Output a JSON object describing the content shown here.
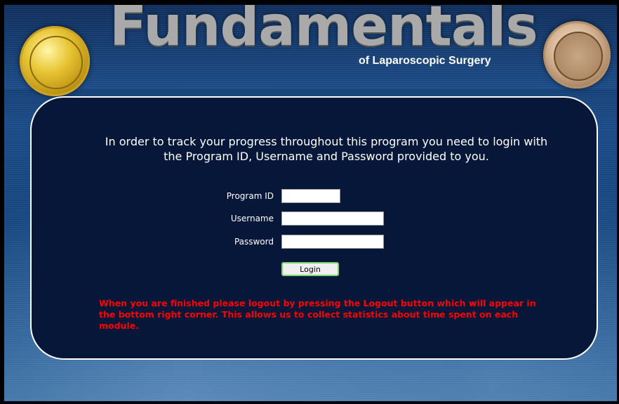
{
  "header": {
    "title": "Fundamentals",
    "subtitle": "of Laparoscopic Surgery"
  },
  "icons": {
    "left_seal": "gold-emblem-seal",
    "right_seal": "college-of-surgeons-seal"
  },
  "login": {
    "intro_text": "In order to track your progress throughout this program you need to login with the Program ID, Username and Password provided to you.",
    "program_id_label": "Program ID",
    "program_id_value": "",
    "username_label": "Username",
    "username_value": "",
    "password_label": "Password",
    "password_value": "",
    "login_button": "Login",
    "notice": "When you are finished please logout by pressing the Logout button which will appear in the bottom right corner. This allows us to collect statistics about time spent on each module."
  },
  "colors": {
    "panel_bg": "#06173a",
    "notice": "#ff0000",
    "button_border": "#7ed36c"
  }
}
